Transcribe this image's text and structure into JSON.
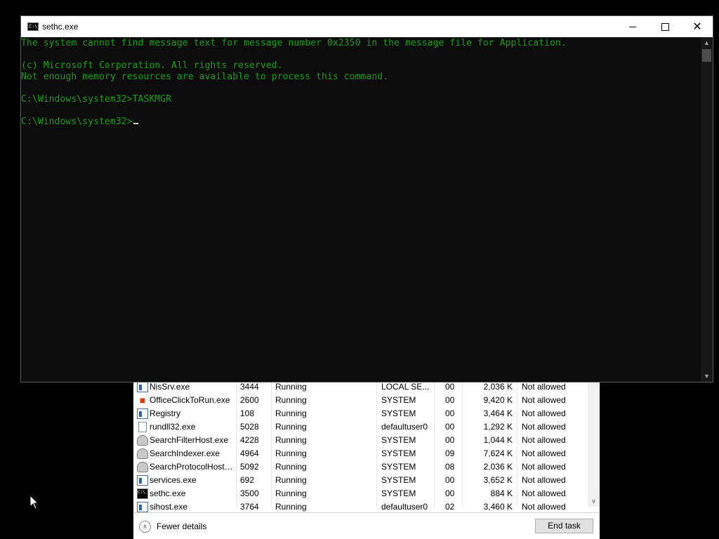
{
  "console": {
    "title": "sethc.exe",
    "lines": [
      "The system cannot find message text for message number 0x2350 in the message file for Application.",
      "",
      "(c) Microsoft Corporation. All rights reserved.",
      "Not enough memory resources are available to process this command.",
      "",
      "C:\\Windows\\system32>TASKMGR",
      "",
      "C:\\Windows\\system32>"
    ],
    "close_glyph": "✕"
  },
  "taskmanager": {
    "rows": [
      {
        "name": "NisSrv.exe",
        "pid": "3444",
        "status": "Running",
        "user": "LOCAL SE...",
        "cpu": "00",
        "memory": "2,036 K",
        "uac": "Not allowed",
        "icon": "app-icon"
      },
      {
        "name": "OfficeClickToRun.exe",
        "pid": "2600",
        "status": "Running",
        "user": "SYSTEM",
        "cpu": "00",
        "memory": "9,420 K",
        "uac": "Not allowed",
        "icon": "office-icon"
      },
      {
        "name": "Registry",
        "pid": "108",
        "status": "Running",
        "user": "SYSTEM",
        "cpu": "00",
        "memory": "3,464 K",
        "uac": "Not allowed",
        "icon": "app-icon"
      },
      {
        "name": "rundll32.exe",
        "pid": "5028",
        "status": "Running",
        "user": "defaultuser0",
        "cpu": "00",
        "memory": "1,292 K",
        "uac": "Not allowed",
        "icon": "document-icon"
      },
      {
        "name": "SearchFilterHost.exe",
        "pid": "4228",
        "status": "Running",
        "user": "SYSTEM",
        "cpu": "00",
        "memory": "1,044 K",
        "uac": "Not allowed",
        "icon": "search-icon"
      },
      {
        "name": "SearchIndexer.exe",
        "pid": "4964",
        "status": "Running",
        "user": "SYSTEM",
        "cpu": "09",
        "memory": "7,624 K",
        "uac": "Not allowed",
        "icon": "search-icon"
      },
      {
        "name": "SearchProtocolHost....",
        "pid": "5092",
        "status": "Running",
        "user": "SYSTEM",
        "cpu": "08",
        "memory": "2,036 K",
        "uac": "Not allowed",
        "icon": "search-icon"
      },
      {
        "name": "services.exe",
        "pid": "692",
        "status": "Running",
        "user": "SYSTEM",
        "cpu": "00",
        "memory": "3,652 K",
        "uac": "Not allowed",
        "icon": "app-icon"
      },
      {
        "name": "sethc.exe",
        "pid": "3500",
        "status": "Running",
        "user": "SYSTEM",
        "cpu": "00",
        "memory": "884 K",
        "uac": "Not allowed",
        "icon": "console-icon"
      },
      {
        "name": "sihost.exe",
        "pid": "3764",
        "status": "Running",
        "user": "defaultuser0",
        "cpu": "02",
        "memory": "3,460 K",
        "uac": "Not allowed",
        "icon": "app-icon"
      }
    ],
    "fewer_details_label": "Fewer details",
    "end_task_label": "End task",
    "scroll_down_glyph": "∨"
  },
  "colors": {
    "console_bg": "#0c0c0c",
    "console_text": "#13a10e"
  }
}
